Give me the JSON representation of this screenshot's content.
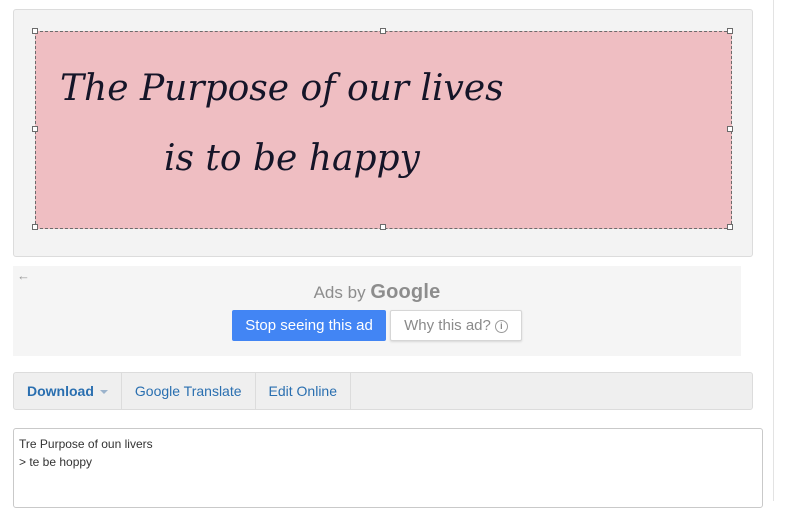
{
  "preview": {
    "handwriting_line_1": "The Purpose of our lives",
    "handwriting_line_2": "is to be happy"
  },
  "ad": {
    "back_icon": "arrow-left-icon",
    "ads_by": "Ads by",
    "google": "Google",
    "stop_button": "Stop seeing this ad",
    "why_button": "Why this ad?",
    "why_icon": "info-icon"
  },
  "toolbar": {
    "download": "Download",
    "translate": "Google Translate",
    "edit": "Edit Online"
  },
  "output": {
    "text": "Tre Purpose of oun livers\n> te be hoppy"
  },
  "colors": {
    "photo_bg": "#efbec2",
    "link_blue": "#2a6fb0",
    "google_blue": "#4285f4"
  }
}
